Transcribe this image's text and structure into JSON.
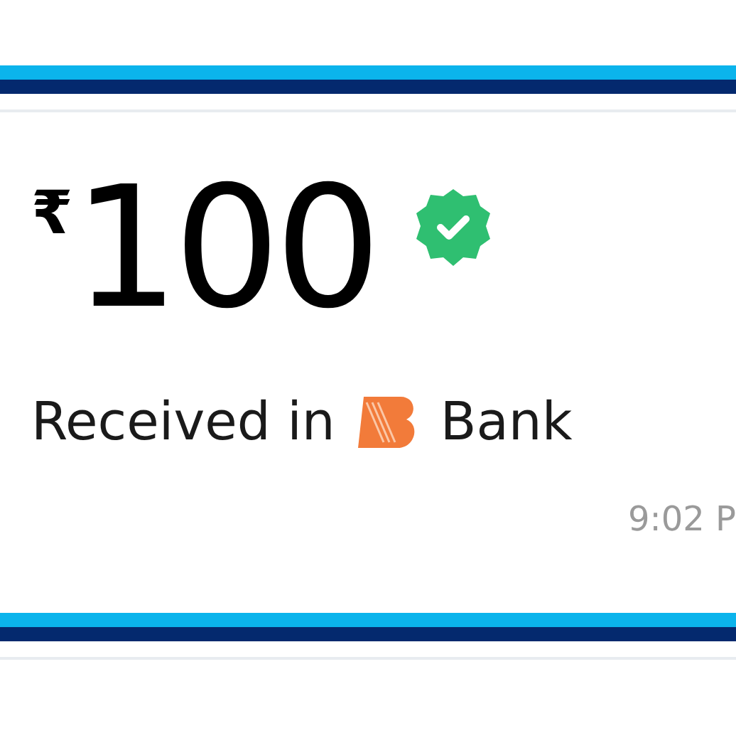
{
  "transactions": [
    {
      "currency": "₹",
      "amount": "100",
      "verified": true,
      "received_prefix": "Received in",
      "bank": "Bank",
      "time": "9:02 P"
    }
  ]
}
